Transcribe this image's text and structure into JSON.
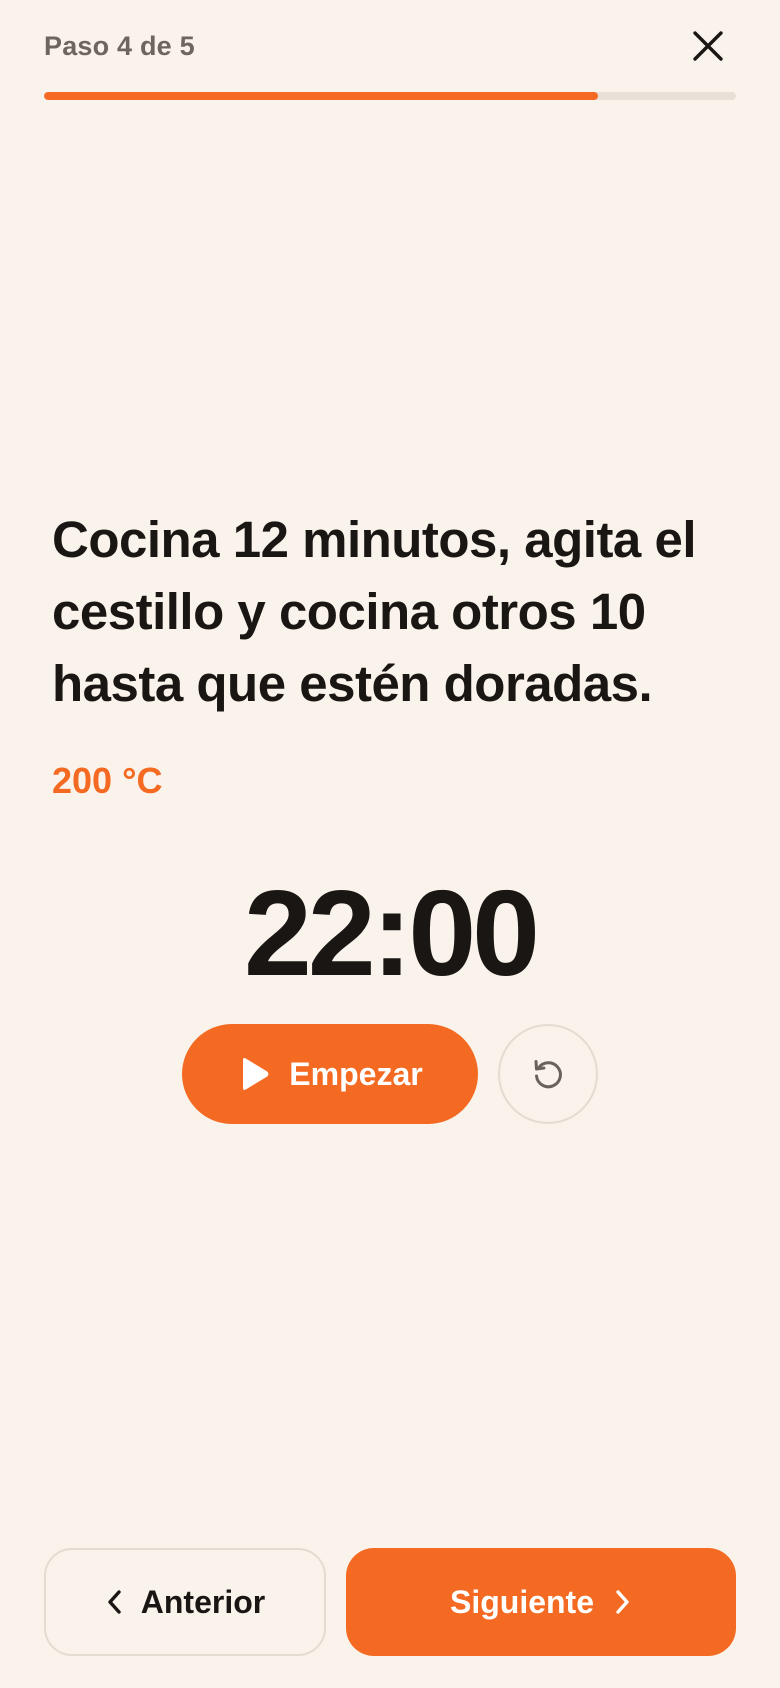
{
  "header": {
    "step_label": "Paso 4 de 5",
    "close_icon": "close-icon"
  },
  "progress": {
    "current_step": 4,
    "total_steps": 5,
    "fraction": 0.8
  },
  "step": {
    "instruction": "Cocina 12 minutos, agita el cestillo y cocina otros 10 hasta que estén doradas.",
    "temperature": "200 °C"
  },
  "timer": {
    "display": "22:00",
    "start_label": "Empezar",
    "start_icon": "play-icon",
    "reset_icon": "reset-icon"
  },
  "footer": {
    "previous_label": "Anterior",
    "previous_icon": "chevron-left-icon",
    "next_label": "Siguiente",
    "next_icon": "chevron-right-icon"
  },
  "colors": {
    "accent": "#F46A23",
    "background": "#FAF3EB",
    "text": "#1A1614",
    "muted_text": "#6E6560",
    "track": "#E7E0D7"
  }
}
